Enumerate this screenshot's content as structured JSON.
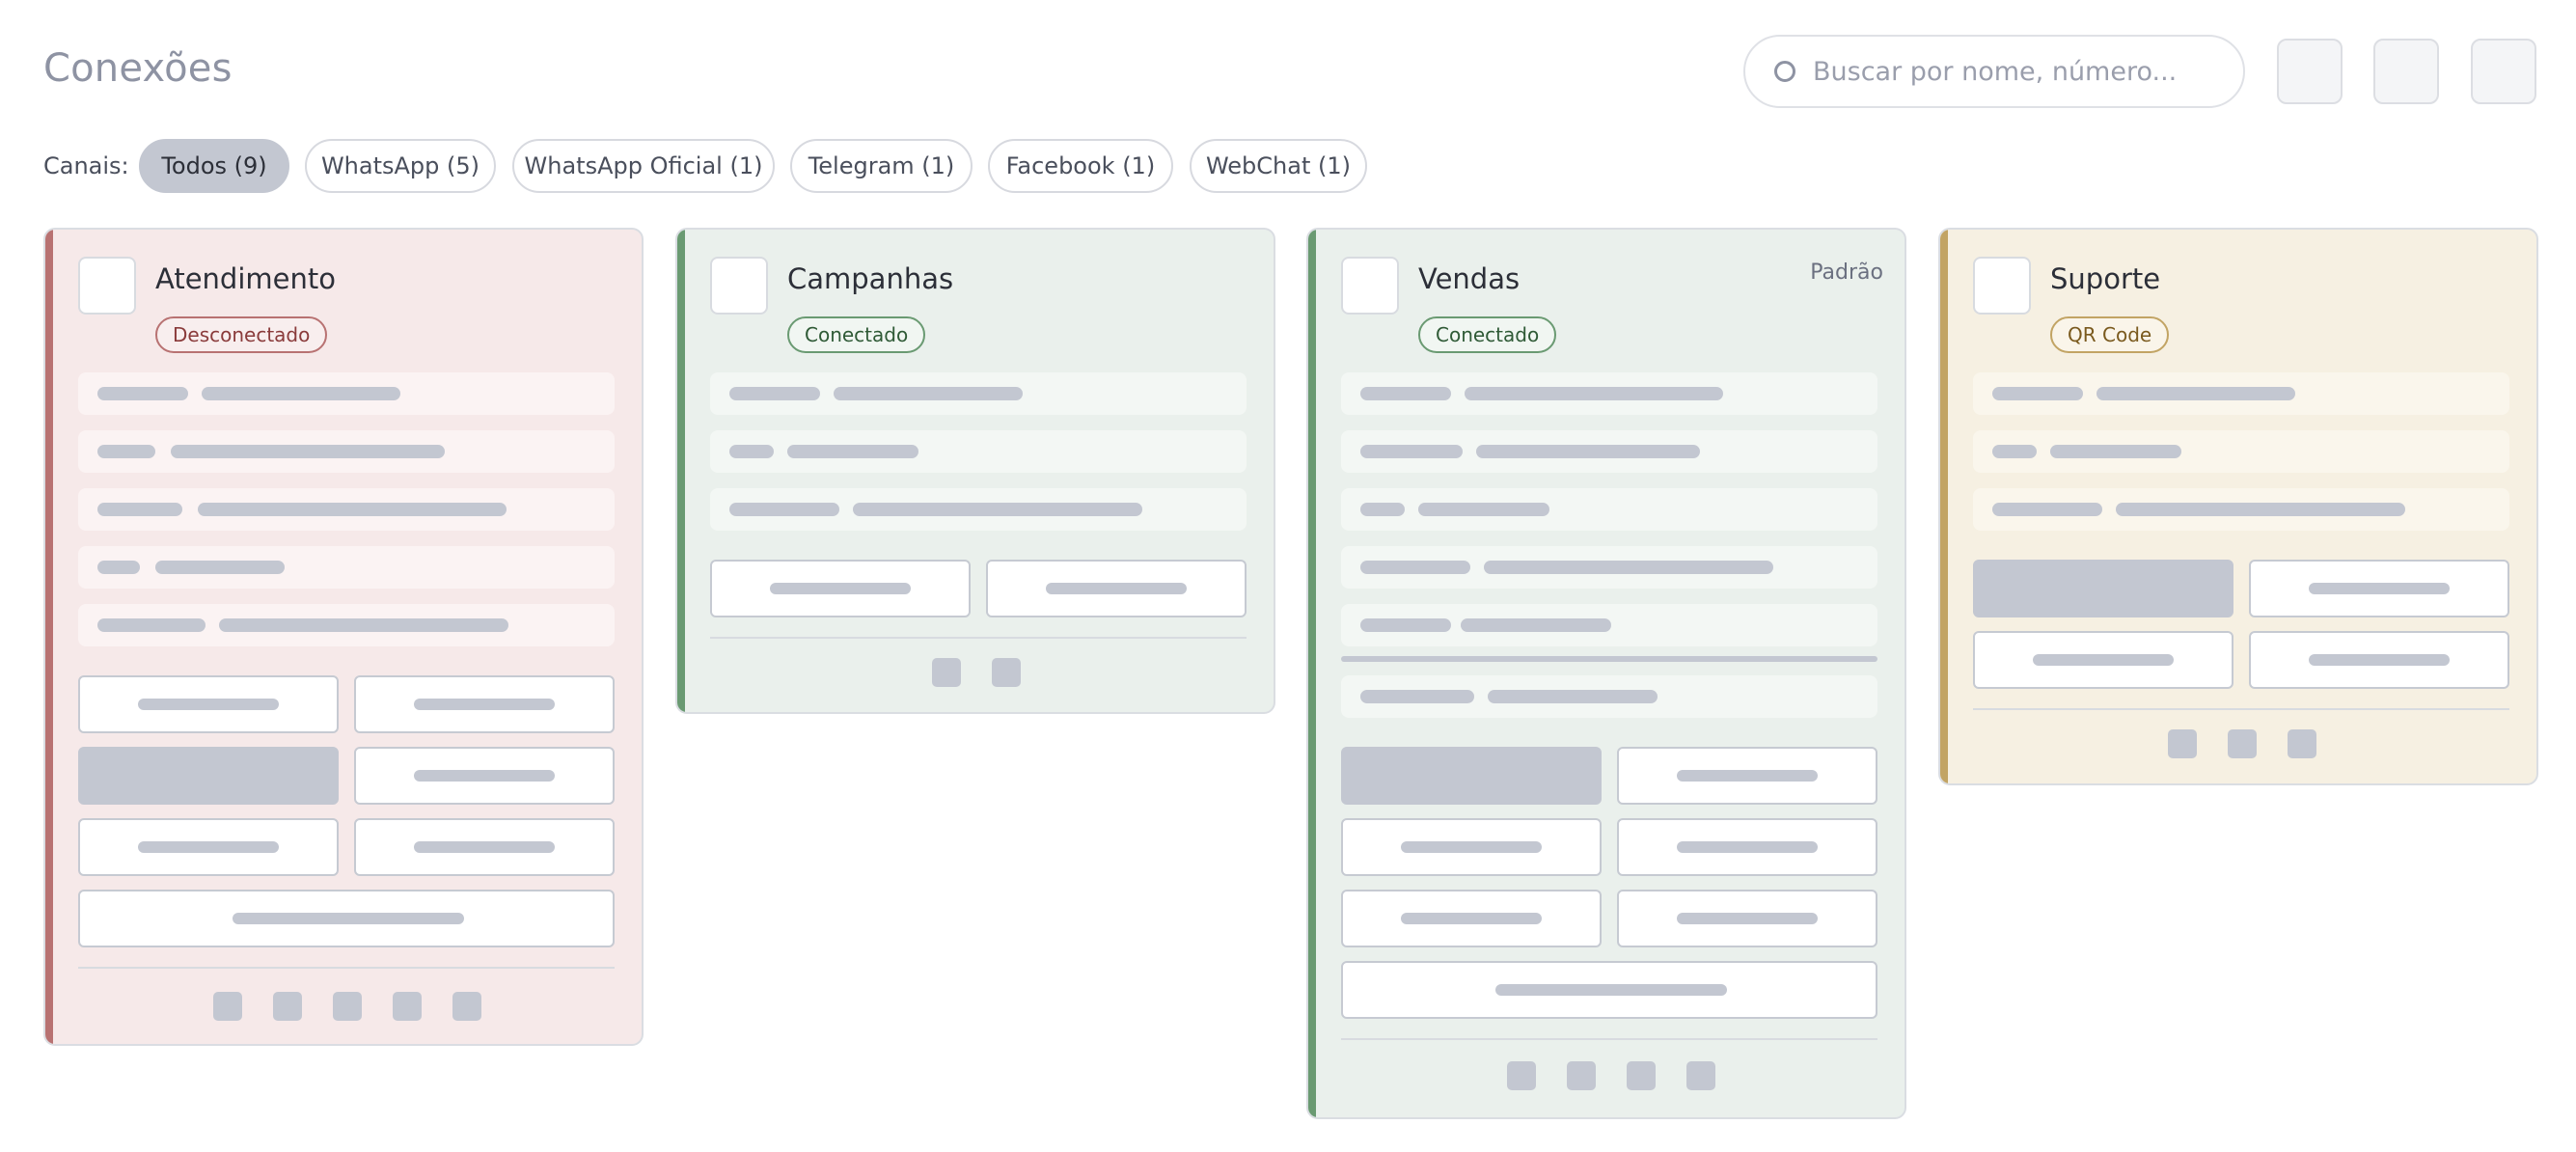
{
  "header": {
    "title": "Conexões",
    "search_placeholder": "Buscar por nome, número..."
  },
  "channels": {
    "label": "Canais:",
    "chips": [
      {
        "label": "Todos (9)",
        "active": true
      },
      {
        "label": "WhatsApp (5)",
        "active": false
      },
      {
        "label": "WhatsApp Oficial (1)",
        "active": false
      },
      {
        "label": "Telegram (1)",
        "active": false
      },
      {
        "label": "Facebook (1)",
        "active": false
      },
      {
        "label": "WebChat (1)",
        "active": false
      }
    ]
  },
  "cards": [
    {
      "title": "Atendimento",
      "status": "Desconectado",
      "default_tag": ""
    },
    {
      "title": "Campanhas",
      "status": "Conectado",
      "default_tag": ""
    },
    {
      "title": "Vendas",
      "status": "Conectado",
      "default_tag": "Padrão"
    },
    {
      "title": "Suporte",
      "status": "QR Code",
      "default_tag": ""
    }
  ],
  "colors": {
    "disconnected_bg": "#f6e9e9",
    "disconnected_accent": "#b87272",
    "connected_bg": "#eaf0ec",
    "connected_accent": "#6a9a72",
    "qrcode_bg": "#f6f0e2",
    "qrcode_accent": "#c2a464",
    "placeholder_gray": "#c3c7d1"
  }
}
